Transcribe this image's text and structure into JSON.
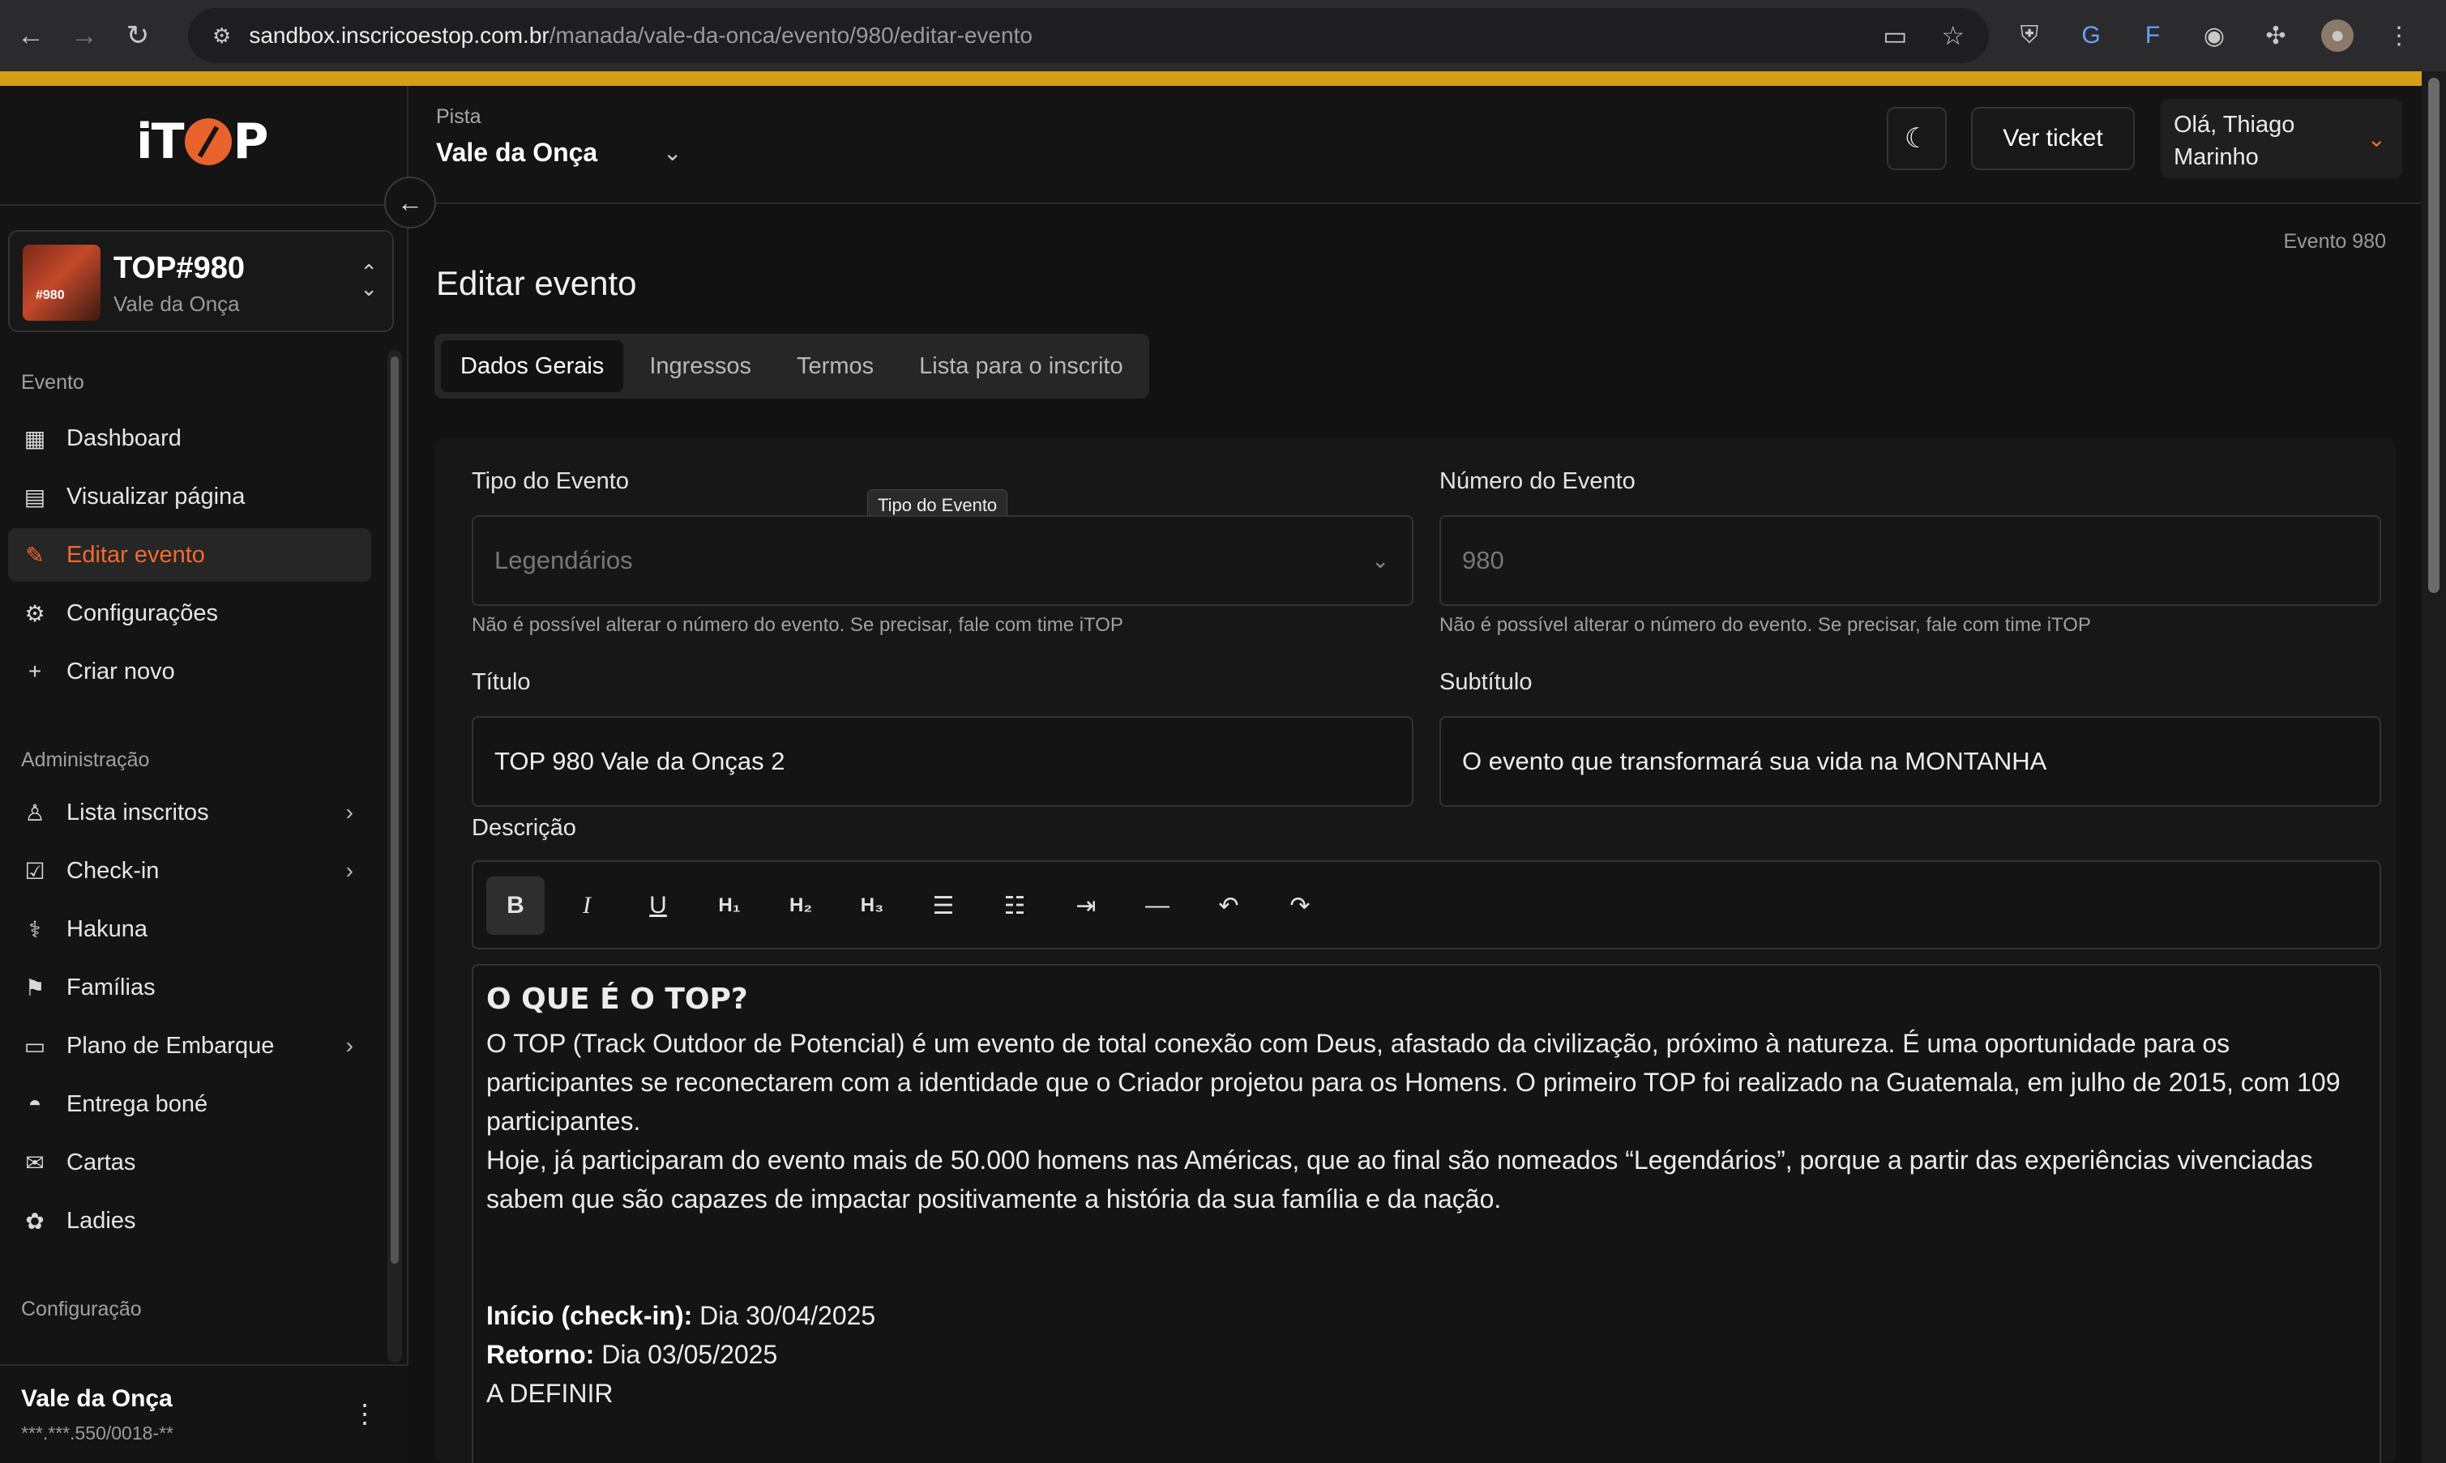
{
  "browser": {
    "url_host": "sandbox.inscricoestop.com.br",
    "url_path": "/manada/vale-da-onca/evento/980/editar-evento"
  },
  "sidebar": {
    "logo_text_left": "iT",
    "logo_text_right": "P",
    "event": {
      "name": "TOP#980",
      "subtitle": "Vale da Onça",
      "thumb_label": "#980"
    },
    "sections": {
      "evento": "Evento",
      "administracao": "Administração",
      "configuracao": "Configuração"
    },
    "evento_items": [
      {
        "label": "Dashboard"
      },
      {
        "label": "Visualizar página"
      },
      {
        "label": "Editar evento"
      },
      {
        "label": "Configurações"
      },
      {
        "label": "Criar novo"
      }
    ],
    "admin_items": [
      {
        "label": "Lista inscritos"
      },
      {
        "label": "Check-in"
      },
      {
        "label": "Hakuna"
      },
      {
        "label": "Famílias"
      },
      {
        "label": "Plano de Embarque"
      },
      {
        "label": "Entrega boné"
      },
      {
        "label": "Cartas"
      },
      {
        "label": "Ladies"
      }
    ],
    "org": {
      "name": "Vale da Onça",
      "doc": "***.***.550/0018-**"
    }
  },
  "topbar": {
    "pista_label": "Pista",
    "pista_value": "Vale da Onça",
    "ticket_button": "Ver ticket",
    "user_greeting_line1": "Olá, Thiago",
    "user_greeting_line2": "Marinho"
  },
  "main": {
    "breadcrumb": "Evento 980",
    "title": "Editar evento",
    "tabs": [
      {
        "label": "Dados Gerais"
      },
      {
        "label": "Ingressos"
      },
      {
        "label": "Termos"
      },
      {
        "label": "Lista para o inscrito"
      }
    ],
    "form": {
      "tipo_label": "Tipo do Evento",
      "tipo_value": "Legendários",
      "tipo_tooltip": "Tipo do Evento",
      "tipo_hint": "Não é possível alterar o número do evento.  Se precisar, fale com time iTOP",
      "numero_label": "Número do Evento",
      "numero_value": "980",
      "numero_hint": "Não é possível alterar o número do evento.  Se precisar, fale com time iTOP",
      "titulo_label": "Título",
      "titulo_value": "TOP 980 Vale da Onças 2",
      "subtitulo_label": "Subtítulo",
      "subtitulo_value": "O evento que transformará sua vida na MONTANHA",
      "descricao_label": "Descrição"
    },
    "editor": {
      "heading": "O QUE É O TOP?",
      "para1": "O TOP (Track Outdoor de Potencial) é um evento de total conexão com Deus, afastado da civilização, próximo à natureza. É uma oportunidade para os participantes se reconectarem com a identidade que o Criador projetou para os Homens. O primeiro TOP foi realizado na Guatemala, em julho de 2015, com 109 participantes.",
      "para2": "Hoje, já participaram do evento mais de 50.000 homens nas Américas, que ao final são nomeados “Legendários”, porque a partir das experiências vivenciadas sabem que são capazes de impactar positivamente a história da sua família e da nação.",
      "inicio_label": "Início (check-in):",
      "inicio_value": " Dia 30/04/2025",
      "retorno_label": "Retorno:",
      "retorno_value": " Dia 03/05/2025",
      "extra": "A DEFINIR"
    }
  },
  "colors": {
    "accent": "#f26a2e",
    "browser_bar": "#d4a017"
  }
}
